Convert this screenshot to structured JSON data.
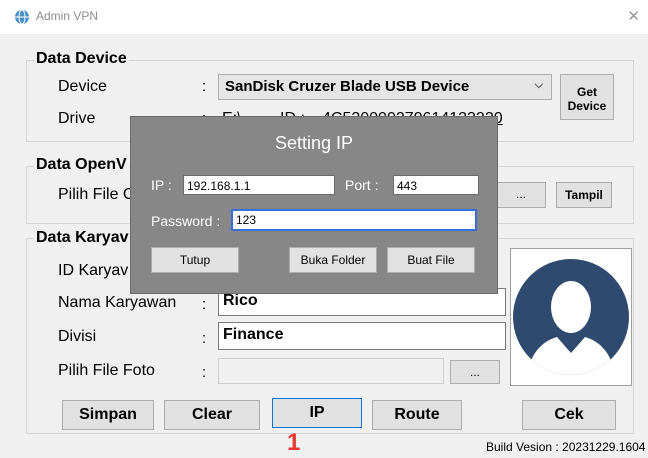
{
  "window": {
    "title": "Admin VPN",
    "close_glyph": "✕"
  },
  "data_device": {
    "title": "Data Device",
    "device_label": "Device",
    "drive_label": "Drive",
    "device_value": "SanDisk Cruzer Blade USB Device",
    "drive_value": "E:\\",
    "id_label": "ID :",
    "id_value": "4C530000270614123220",
    "get_device": "Get Device"
  },
  "data_openvpn": {
    "title": "Data OpenV",
    "pilih_file_label": "Pilih File C",
    "browse": "...",
    "tampil": "Tampil"
  },
  "data_karyawan": {
    "title": "Data Karyav",
    "id_label": "ID Karyav",
    "nama_label": "Nama Karyawan",
    "nama_value": "Rico",
    "divisi_label": "Divisi",
    "divisi_value": "Finance",
    "foto_label": "Pilih File Foto",
    "browse": "..."
  },
  "colon": ":",
  "buttons": {
    "simpan": "Simpan",
    "clear": "Clear",
    "ip": "IP",
    "route": "Route",
    "cek": "Cek"
  },
  "annotation": "1",
  "build": "Build Vesion : 20231229.1604",
  "setting_ip": {
    "title": "Setting IP",
    "ip_label": "IP :",
    "ip_value": "192.168.1.1",
    "port_label": "Port :",
    "port_value": "443",
    "password_label": "Password :",
    "password_value": "123",
    "tutup": "Tutup",
    "buka_folder": "Buka Folder",
    "buat_file": "Buat File"
  }
}
